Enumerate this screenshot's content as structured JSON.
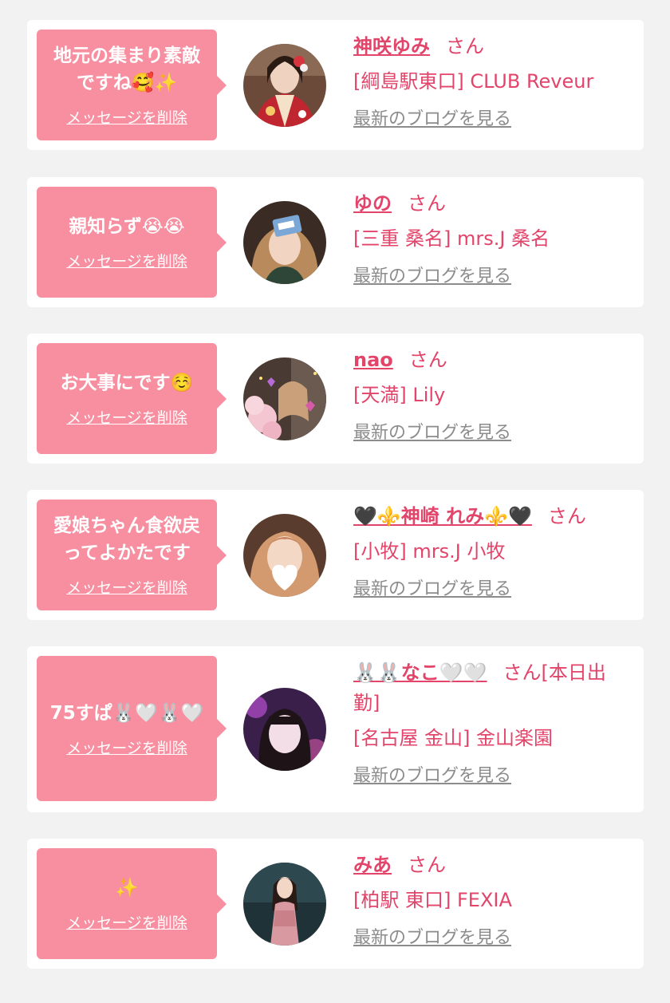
{
  "colors": {
    "page_bg": "#f2f2f2",
    "card_bg": "#ffffff",
    "bubble_bg": "#f78fa0",
    "name_color": "#e2446a",
    "blog_link_color": "#8c8c8c"
  },
  "common": {
    "delete_label": "メッセージを削除",
    "honorific": "さん",
    "blog_label": "最新のブログを見る"
  },
  "items": [
    {
      "message": "地元の集まり素敵ですね🥰✨",
      "name": "神咲ゆみ",
      "suffix": "",
      "shop": "[綱島駅東口] CLUB Reveur",
      "avatar_icon": "woman-in-kimono-avatar"
    },
    {
      "message": "親知らず😭😭",
      "name": "ゆの",
      "suffix": "",
      "shop": "[三重 桑名] mrs.J 桑名",
      "avatar_icon": "woman-holding-card-avatar"
    },
    {
      "message": "お大事にです☺️",
      "name": "nao",
      "suffix": "",
      "shop": "[天満] Lily",
      "avatar_icon": "woman-with-flowers-avatar"
    },
    {
      "message": "愛娘ちゃん食欲戻ってよかたです",
      "name": "🖤⚜️神崎 れみ⚜️🖤",
      "suffix": "",
      "shop": "[小牧] mrs.J 小牧",
      "avatar_icon": "woman-with-heart-sticker-avatar"
    },
    {
      "message": "75すぱ🐰🤍🐰🤍",
      "name": "🐰🐰なこ🤍🤍",
      "suffix": "[本日出勤]",
      "shop": "[名古屋 金山] 金山楽園",
      "avatar_icon": "woman-purple-light-avatar"
    },
    {
      "message": "✨",
      "name": "みあ",
      "suffix": "",
      "shop": "[柏駅 東口] FEXIA",
      "avatar_icon": "woman-in-dress-avatar"
    }
  ]
}
